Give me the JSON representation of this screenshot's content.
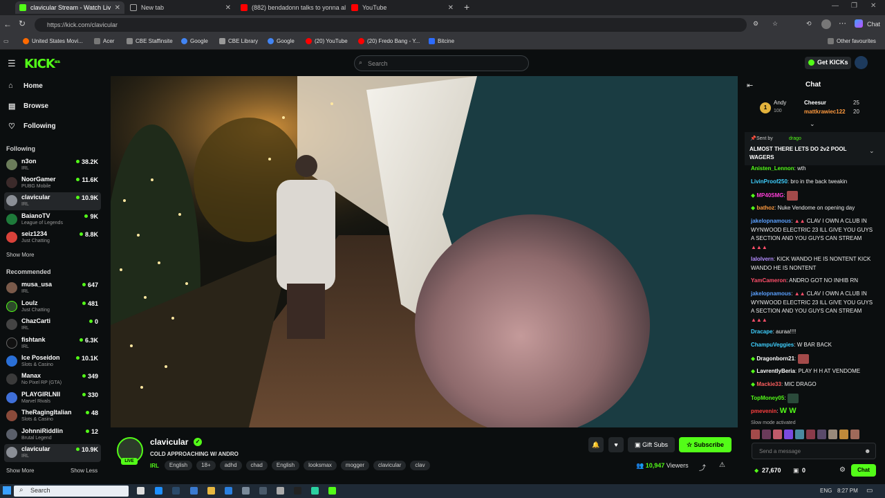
{
  "browser": {
    "tabs": [
      {
        "title": "clavicular Stream - Watch Liv",
        "active": true
      },
      {
        "title": "New tab"
      },
      {
        "title": "(882) bendadonn talks to yonna al"
      },
      {
        "title": "YouTube"
      }
    ],
    "url": "https://kick.com/clavicular",
    "copilot_label": "Chat",
    "bookmarks": [
      "United States Movi...",
      "Acer",
      "CBE Staffinsite",
      "Google",
      "CBE Library",
      "Google",
      "(20) YouTube",
      "(20) Fredo Bang - Y...",
      "Bitcine"
    ],
    "other_favourites": "Other favourites"
  },
  "kick": {
    "logo": "KICK",
    "logo_beta": "BETA",
    "search_placeholder": "Search",
    "get_kicks": "Get KICKs"
  },
  "sidebar": {
    "nav": [
      {
        "label": "Home",
        "icon": "home-icon"
      },
      {
        "label": "Browse",
        "icon": "browse-icon"
      },
      {
        "label": "Following",
        "icon": "heart-icon"
      }
    ],
    "following_heading": "Following",
    "following": [
      {
        "name": "n3on",
        "category": "IRL",
        "viewers": "38.2K"
      },
      {
        "name": "NoorGamer",
        "category": "PUBG Mobile",
        "viewers": "11.6K"
      },
      {
        "name": "clavicular",
        "category": "IRL",
        "viewers": "10.9K"
      },
      {
        "name": "BaianoTV",
        "category": "League of Legends",
        "viewers": "9K"
      },
      {
        "name": "seiz1234",
        "category": "Just Chatting",
        "viewers": "8.8K"
      }
    ],
    "show_more_1": "Show More",
    "recommended_heading": "Recommended",
    "recommended": [
      {
        "name": "musa_usa",
        "category": "IRL",
        "viewers": "647"
      },
      {
        "name": "Loulz",
        "category": "Just Chatting",
        "viewers": "481"
      },
      {
        "name": "ChazCarti",
        "category": "IRL",
        "viewers": "0"
      },
      {
        "name": "fishtank",
        "category": "IRL",
        "viewers": "6.3K"
      },
      {
        "name": "Ice Poseidon",
        "category": "Slots & Casino",
        "viewers": "10.1K"
      },
      {
        "name": "Manax",
        "category": "No Pixel RP (GTA)",
        "viewers": "349"
      },
      {
        "name": "PLAYGIRLNII",
        "category": "Marvel Rivals",
        "viewers": "330"
      },
      {
        "name": "TheRagingItalian",
        "category": "Slots & Casino",
        "viewers": "48"
      },
      {
        "name": "JohnniRiddlin",
        "category": "Brutal Legend",
        "viewers": "12"
      },
      {
        "name": "clavicular",
        "category": "IRL",
        "viewers": "10.9K"
      }
    ],
    "show_more_2": "Show More",
    "show_less": "Show Less"
  },
  "stream": {
    "streamer": "clavicular",
    "live_badge": "LIVE",
    "title": "COLD APPROACHING W/ ANDRO",
    "category": "IRL",
    "tags": [
      "English",
      "18+",
      "adhd",
      "chad",
      "English",
      "looksmax",
      "mogger",
      "clavicular",
      "clav"
    ],
    "gift_subs": "Gift Subs",
    "subscribe": "Subscribe",
    "viewer_count": "10,947",
    "viewers_label": "Viewers"
  },
  "chat": {
    "title": "Chat",
    "leaderboard": [
      {
        "rank": "1",
        "name": "Andy",
        "points": "100"
      },
      {
        "name": "Cheesur",
        "points": "25"
      },
      {
        "name": "mattkrawiec122",
        "points": "20"
      }
    ],
    "pinned_by_label": "Sent by",
    "pinned_by": "drago",
    "pinned_text": "ALMOST THERE LETS DO 2v2 POOL WAGERS",
    "messages": [
      {
        "user": "Anisten_Lennon",
        "text": "wth",
        "color": "#53fc18"
      },
      {
        "user": "LivinProof250",
        "text": "bro in the back tweakin",
        "color": "#3fd0ff"
      },
      {
        "user": "MP40SMG",
        "text": "",
        "color": "#ff3fd8"
      },
      {
        "user": "bathoz",
        "text": "Nuke Vendome on opening day",
        "color": "#ff9a3f"
      },
      {
        "user": "jakelopnamous",
        "text": "CLAV I OWN A CLUB IN WYNWOOD ELECTRIC 23 ILL GIVE YOU GUYS A SECTION AND YOU GUYS CAN STREAM",
        "color": "#5aa0ff"
      },
      {
        "user": "lalolvern",
        "text": "KICK WANDO HE IS NONTENT KICK WANDO HE IS NONTENT",
        "color": "#b48cff"
      },
      {
        "user": "YamCameron",
        "text": "ANDRO GOT NO INHIB RN",
        "color": "#ff4f6a"
      },
      {
        "user": "jakelopnamous",
        "text": "CLAV I OWN A CLUB IN WYNWOOD ELECTRIC 23 ILL GIVE YOU GUYS A SECTION AND YOU GUYS CAN STREAM",
        "color": "#5aa0ff"
      },
      {
        "user": "Dracape",
        "text": "auraa!!!!",
        "color": "#3fd0ff"
      },
      {
        "user": "ChampuVeggies",
        "text": "W BAR BACK",
        "color": "#3fd0ff"
      },
      {
        "user": "Dragonborn21",
        "text": "",
        "color": "#ffffff"
      },
      {
        "user": "LavrentlyBeria",
        "text": "PLAY H H AT VENDOME",
        "color": "#ffffff"
      },
      {
        "user": "Mackie33",
        "text": "MIC DRAGO",
        "color": "#ff5f5f"
      },
      {
        "user": "TopMoney05",
        "text": "",
        "color": "#53fc18"
      },
      {
        "user": "pmevenin",
        "text": "W W",
        "color": "#ff3f3f"
      }
    ],
    "slow_mode": "Slow mode activated",
    "input_placeholder": "Send a message",
    "kicks_balance": "27,670",
    "subs_count": "0",
    "send_label": "Chat"
  },
  "taskbar": {
    "search_placeholder": "Search",
    "language": "ENG",
    "time": "8:27 PM"
  }
}
